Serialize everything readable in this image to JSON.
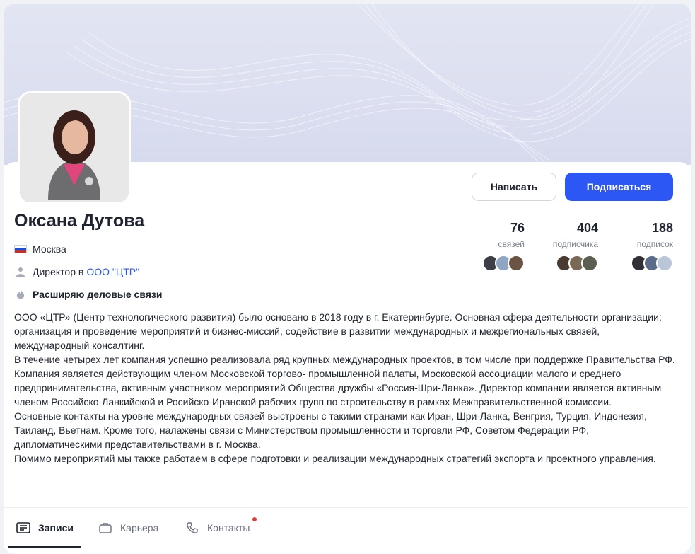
{
  "profile": {
    "name": "Оксана Дутова",
    "city": "Москва",
    "job_prefix": "Директор в",
    "company": "ООО \"ЦТР\"",
    "goal": "Расширяю деловые связи"
  },
  "actions": {
    "write_label": "Написать",
    "subscribe_label": "Подписаться"
  },
  "stats": [
    {
      "value": "76",
      "label": "связей"
    },
    {
      "value": "404",
      "label": "подписчика"
    },
    {
      "value": "188",
      "label": "подписок"
    }
  ],
  "about": [
    "ООО «ЦТР» (Центр технологического развития) было основано в 2018 году в г. Екатеринбурге. Основная сфера деятельности организации: организация и проведение мероприятий и бизнес-миссий, содействие в развитии международных и межрегиональных связей, международный консалтинг.",
    "В течение четырех лет компания успешно реализовала ряд крупных международных проектов, в том числе при поддержке Правительства РФ. Компания является действующим членом Московской торгово- промышленной палаты, Московской ассоциации малого и среднего предпринимательства, активным участником мероприятий Общества дружбы «Россия-Шри-Ланка». Директор компании является активным членом Российско-Ланкийской и Росийско-Иранской рабочих групп по строительству в рамках Межправительственной комиссии.",
    "Основные контакты на уровне международных связей выстроены с такими странами как Иран, Шри-Ланка, Венгрия, Турция, Индонезия, Таиланд, Вьетнам. Кроме того, налажены связи с Министерством промышленности и торговли РФ, Советом Федерации РФ, дипломатическими представительствами в г. Москва.",
    "Помимо мероприятий мы также работаем в сфере подготовки и реализации международных стратегий экспорта и проектного управления."
  ],
  "tabs": [
    {
      "label": "Записи",
      "icon": "posts-icon",
      "active": true
    },
    {
      "label": "Карьера",
      "icon": "briefcase-icon",
      "active": false
    },
    {
      "label": "Контакты",
      "icon": "phone-icon",
      "active": false,
      "badge_dot": true
    }
  ],
  "colors": {
    "accent": "#2d57f5",
    "text": "#1f2430",
    "muted": "#7a7f8c",
    "badge": "#e53935"
  }
}
